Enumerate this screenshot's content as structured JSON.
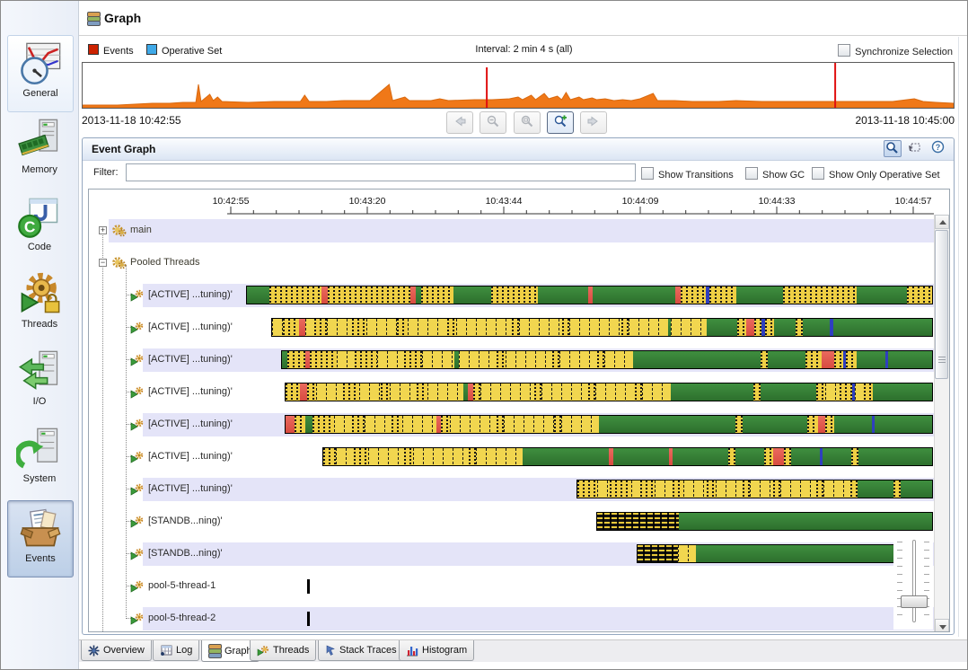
{
  "header": {
    "title": "Graph"
  },
  "legend": {
    "events_label": "Events",
    "operative_label": "Operative Set",
    "events_color": "#cc2200",
    "operative_color": "#3fa9e8",
    "interval_label": "Interval: 2 min 4 s (all)",
    "sync_label": "Synchronize Selection"
  },
  "overview_strip": {
    "start_time": "2013-11-18 10:42:55",
    "end_time": "2013-11-18 10:45:00",
    "area_color": "#f07818",
    "spike_color": "#e01010",
    "points": [
      [
        0,
        3
      ],
      [
        0.04,
        3
      ],
      [
        0.06,
        4
      ],
      [
        0.08,
        5
      ],
      [
        0.1,
        5
      ],
      [
        0.115,
        6
      ],
      [
        0.13,
        6
      ],
      [
        0.133,
        26
      ],
      [
        0.136,
        7
      ],
      [
        0.146,
        15
      ],
      [
        0.15,
        8
      ],
      [
        0.155,
        12
      ],
      [
        0.16,
        7
      ],
      [
        0.19,
        6
      ],
      [
        0.22,
        7
      ],
      [
        0.25,
        7
      ],
      [
        0.255,
        14
      ],
      [
        0.26,
        7
      ],
      [
        0.28,
        7
      ],
      [
        0.3,
        8
      ],
      [
        0.33,
        8
      ],
      [
        0.352,
        26
      ],
      [
        0.356,
        8
      ],
      [
        0.37,
        12
      ],
      [
        0.375,
        8
      ],
      [
        0.4,
        8
      ],
      [
        0.41,
        10
      ],
      [
        0.42,
        8
      ],
      [
        0.45,
        9
      ],
      [
        0.47,
        9
      ],
      [
        0.49,
        10
      ],
      [
        0.5,
        12
      ],
      [
        0.505,
        9
      ],
      [
        0.515,
        14
      ],
      [
        0.52,
        9
      ],
      [
        0.53,
        16
      ],
      [
        0.535,
        10
      ],
      [
        0.545,
        13
      ],
      [
        0.55,
        9
      ],
      [
        0.555,
        17
      ],
      [
        0.56,
        9
      ],
      [
        0.57,
        12
      ],
      [
        0.575,
        9
      ],
      [
        0.585,
        11
      ],
      [
        0.59,
        9
      ],
      [
        0.6,
        10
      ],
      [
        0.61,
        8
      ],
      [
        0.62,
        9
      ],
      [
        0.63,
        8
      ],
      [
        0.64,
        10
      ],
      [
        0.655,
        16
      ],
      [
        0.66,
        8
      ],
      [
        0.68,
        8
      ],
      [
        0.7,
        7
      ],
      [
        0.73,
        7
      ],
      [
        0.75,
        8
      ],
      [
        0.78,
        7
      ],
      [
        0.8,
        7
      ],
      [
        0.83,
        7
      ],
      [
        0.86,
        7
      ],
      [
        0.9,
        7
      ],
      [
        0.93,
        7
      ],
      [
        0.955,
        10
      ],
      [
        0.965,
        7
      ],
      [
        0.98,
        6
      ],
      [
        1,
        5
      ]
    ],
    "red_spikes": [
      [
        0.464,
        45
      ],
      [
        0.864,
        50
      ]
    ]
  },
  "nav": {
    "buttons": [
      "back",
      "zoom-out",
      "zoom-fit",
      "zoom-in",
      "forward"
    ],
    "active": "zoom-in"
  },
  "event_graph": {
    "title": "Event Graph",
    "filter_label": "Filter:",
    "filter_value": "",
    "options": [
      "Show Transitions",
      "Show GC",
      "Show Only Operative Set"
    ],
    "axis_labels": [
      "10:42:55",
      "10:43:20",
      "10:43:44",
      "10:44:09",
      "10:44:33",
      "10:44:57"
    ],
    "rows": [
      {
        "label": "main",
        "kind": "group",
        "toggle": "+",
        "shade": true
      },
      {
        "label": "Pooled Threads",
        "kind": "group",
        "toggle": "−",
        "shade": false
      },
      {
        "label": "[ACTIVE] ...tuning)'",
        "kind": "thread",
        "shade": true,
        "bar": {
          "start": 272,
          "segments": [
            [
              "g",
              25
            ],
            [
              "h",
              58
            ],
            [
              "r",
              7
            ],
            [
              "h",
              92
            ],
            [
              "r",
              6
            ],
            [
              "g",
              6
            ],
            [
              "h",
              36
            ],
            [
              "g",
              42
            ],
            [
              "h",
              52
            ],
            [
              "g",
              56
            ],
            [
              "r",
              5
            ],
            [
              "g",
              92
            ],
            [
              "r",
              6
            ],
            [
              "h",
              28
            ],
            [
              "b",
              4
            ],
            [
              "h",
              30
            ],
            [
              "g",
              52
            ],
            [
              "h",
              82
            ],
            [
              "g",
              56
            ],
            [
              "h",
              50
            ],
            [
              "g",
              10
            ]
          ]
        }
      },
      {
        "label": "[ACTIVE] ...tuning)'",
        "kind": "thread",
        "shade": false,
        "bar": {
          "start": 300,
          "segments": [
            [
              "y",
              12
            ],
            [
              "h",
              18
            ],
            [
              "r",
              7
            ],
            [
              "y",
              10
            ],
            [
              "h",
              14
            ],
            [
              "y",
              28
            ],
            [
              "h",
              16
            ],
            [
              "y",
              34
            ],
            [
              "h",
              12
            ],
            [
              "y",
              44
            ],
            [
              "h",
              10
            ],
            [
              "y",
              62
            ],
            [
              "h",
              8
            ],
            [
              "y",
              48
            ],
            [
              "h",
              8
            ],
            [
              "y",
              58
            ],
            [
              "h",
              8
            ],
            [
              "y",
              44
            ],
            [
              "g",
              3
            ],
            [
              "y",
              40
            ],
            [
              "g",
              34
            ],
            [
              "h",
              10
            ],
            [
              "r",
              9
            ],
            [
              "h",
              8
            ],
            [
              "b",
              4
            ],
            [
              "h",
              10
            ],
            [
              "g",
              24
            ],
            [
              "h",
              8
            ],
            [
              "g",
              30
            ],
            [
              "b",
              4
            ],
            [
              "g",
              60
            ]
          ]
        }
      },
      {
        "label": "[ACTIVE] ...tuning)'",
        "kind": "thread",
        "shade": true,
        "bar": {
          "start": 311,
          "segments": [
            [
              "g",
              6
            ],
            [
              "h",
              20
            ],
            [
              "r",
              5
            ],
            [
              "h",
              30
            ],
            [
              "y",
              20
            ],
            [
              "h",
              25
            ],
            [
              "y",
              30
            ],
            [
              "h",
              20
            ],
            [
              "y",
              36
            ],
            [
              "g",
              5
            ],
            [
              "y",
              42
            ],
            [
              "h",
              10
            ],
            [
              "y",
              52
            ],
            [
              "h",
              8
            ],
            [
              "y",
              42
            ],
            [
              "h",
              8
            ],
            [
              "y",
              32
            ],
            [
              "g",
              142
            ],
            [
              "h",
              8
            ],
            [
              "g",
              42
            ],
            [
              "h",
              18
            ],
            [
              "r",
              14
            ],
            [
              "h",
              10
            ],
            [
              "b",
              3
            ],
            [
              "h",
              12
            ],
            [
              "g",
              32
            ],
            [
              "b",
              3
            ],
            [
              "g",
              40
            ]
          ]
        }
      },
      {
        "label": "[ACTIVE] ...tuning)'",
        "kind": "thread",
        "shade": false,
        "bar": {
          "start": 315,
          "segments": [
            [
              "h",
              16
            ],
            [
              "r",
              8
            ],
            [
              "h",
              10
            ],
            [
              "y",
              30
            ],
            [
              "h",
              18
            ],
            [
              "y",
              24
            ],
            [
              "h",
              10
            ],
            [
              "y",
              30
            ],
            [
              "h",
              12
            ],
            [
              "y",
              40
            ],
            [
              "g",
              5
            ],
            [
              "r",
              6
            ],
            [
              "h",
              8
            ],
            [
              "y",
              60
            ],
            [
              "h",
              8
            ],
            [
              "y",
              52
            ],
            [
              "h",
              8
            ],
            [
              "y",
              44
            ],
            [
              "h",
              8
            ],
            [
              "y",
              32
            ],
            [
              "g",
              92
            ],
            [
              "h",
              8
            ],
            [
              "g",
              62
            ],
            [
              "h",
              10
            ],
            [
              "y",
              16
            ],
            [
              "h",
              14
            ],
            [
              "b",
              3
            ],
            [
              "y",
              10
            ],
            [
              "h",
              10
            ],
            [
              "g",
              60
            ]
          ]
        }
      },
      {
        "label": "[ACTIVE] ...tuning)'",
        "kind": "thread",
        "shade": true,
        "bar": {
          "start": 315,
          "segments": [
            [
              "r",
              10
            ],
            [
              "h",
              12
            ],
            [
              "g",
              8
            ],
            [
              "h",
              24
            ],
            [
              "y",
              20
            ],
            [
              "h",
              14
            ],
            [
              "y",
              30
            ],
            [
              "h",
              12
            ],
            [
              "y",
              38
            ],
            [
              "r",
              5
            ],
            [
              "h",
              10
            ],
            [
              "y",
              52
            ],
            [
              "h",
              8
            ],
            [
              "y",
              56
            ],
            [
              "h",
              8
            ],
            [
              "y",
              42
            ],
            [
              "g",
              152
            ],
            [
              "h",
              8
            ],
            [
              "g",
              72
            ],
            [
              "h",
              12
            ],
            [
              "r",
              8
            ],
            [
              "h",
              10
            ],
            [
              "g",
              42
            ],
            [
              "b",
              3
            ],
            [
              "g",
              60
            ]
          ]
        }
      },
      {
        "label": "[ACTIVE] ...tuning)'",
        "kind": "thread",
        "shade": false,
        "bar": {
          "start": 357,
          "segments": [
            [
              "h",
              14
            ],
            [
              "y",
              20
            ],
            [
              "h",
              16
            ],
            [
              "y",
              40
            ],
            [
              "h",
              10
            ],
            [
              "y",
              62
            ],
            [
              "h",
              8
            ],
            [
              "y",
              52
            ],
            [
              "g",
              96
            ],
            [
              "r",
              5
            ],
            [
              "g",
              62
            ],
            [
              "r",
              4
            ],
            [
              "g",
              62
            ],
            [
              "h",
              8
            ],
            [
              "g",
              32
            ],
            [
              "h",
              10
            ],
            [
              "r",
              12
            ],
            [
              "h",
              8
            ],
            [
              "g",
              32
            ],
            [
              "b",
              3
            ],
            [
              "g",
              32
            ],
            [
              "h",
              8
            ],
            [
              "g",
              40
            ]
          ]
        }
      },
      {
        "label": "[ACTIVE] ...tuning)'",
        "kind": "thread",
        "shade": true,
        "bar": {
          "start": 640,
          "segments": [
            [
              "h",
              22
            ],
            [
              "y",
              14
            ],
            [
              "h",
              24
            ],
            [
              "y",
              10
            ],
            [
              "h",
              16
            ],
            [
              "y",
              20
            ],
            [
              "h",
              12
            ],
            [
              "y",
              26
            ],
            [
              "h",
              10
            ],
            [
              "y",
              30
            ],
            [
              "h",
              8
            ],
            [
              "y",
              26
            ],
            [
              "h",
              8
            ],
            [
              "y",
              40
            ],
            [
              "h",
              8
            ],
            [
              "y",
              30
            ],
            [
              "h",
              8
            ],
            [
              "g",
              40
            ],
            [
              "h",
              8
            ],
            [
              "g",
              40
            ]
          ]
        }
      },
      {
        "label": "[STANDB...ning)'",
        "kind": "thread",
        "shade": false,
        "bar": {
          "start": 662,
          "segments": [
            [
              "hh",
              91
            ],
            [
              "g",
              284
            ]
          ]
        }
      },
      {
        "label": "[STANDB...ning)'",
        "kind": "thread",
        "shade": true,
        "bar": {
          "start": 707,
          "segments": [
            [
              "hh",
              45
            ],
            [
              "y",
              20
            ],
            [
              "g",
              265
            ]
          ]
        }
      },
      {
        "label": "pool-5-thread-1",
        "kind": "thread",
        "shade": false,
        "tick": 340
      },
      {
        "label": "pool-5-thread-2",
        "kind": "thread",
        "shade": true,
        "tick": 340
      }
    ]
  },
  "sidebar": {
    "items": [
      {
        "label": "General",
        "state": "boxed"
      },
      {
        "label": "Memory",
        "state": "normal"
      },
      {
        "label": "Code",
        "state": "normal"
      },
      {
        "label": "Threads",
        "state": "normal"
      },
      {
        "label": "I/O",
        "state": "normal"
      },
      {
        "label": "System",
        "state": "normal"
      },
      {
        "label": "Events",
        "state": "selected"
      }
    ]
  },
  "tabs": {
    "items": [
      "Overview",
      "Log",
      "Graph",
      "Threads",
      "Stack Traces",
      "Histogram"
    ],
    "selected": "Graph"
  }
}
